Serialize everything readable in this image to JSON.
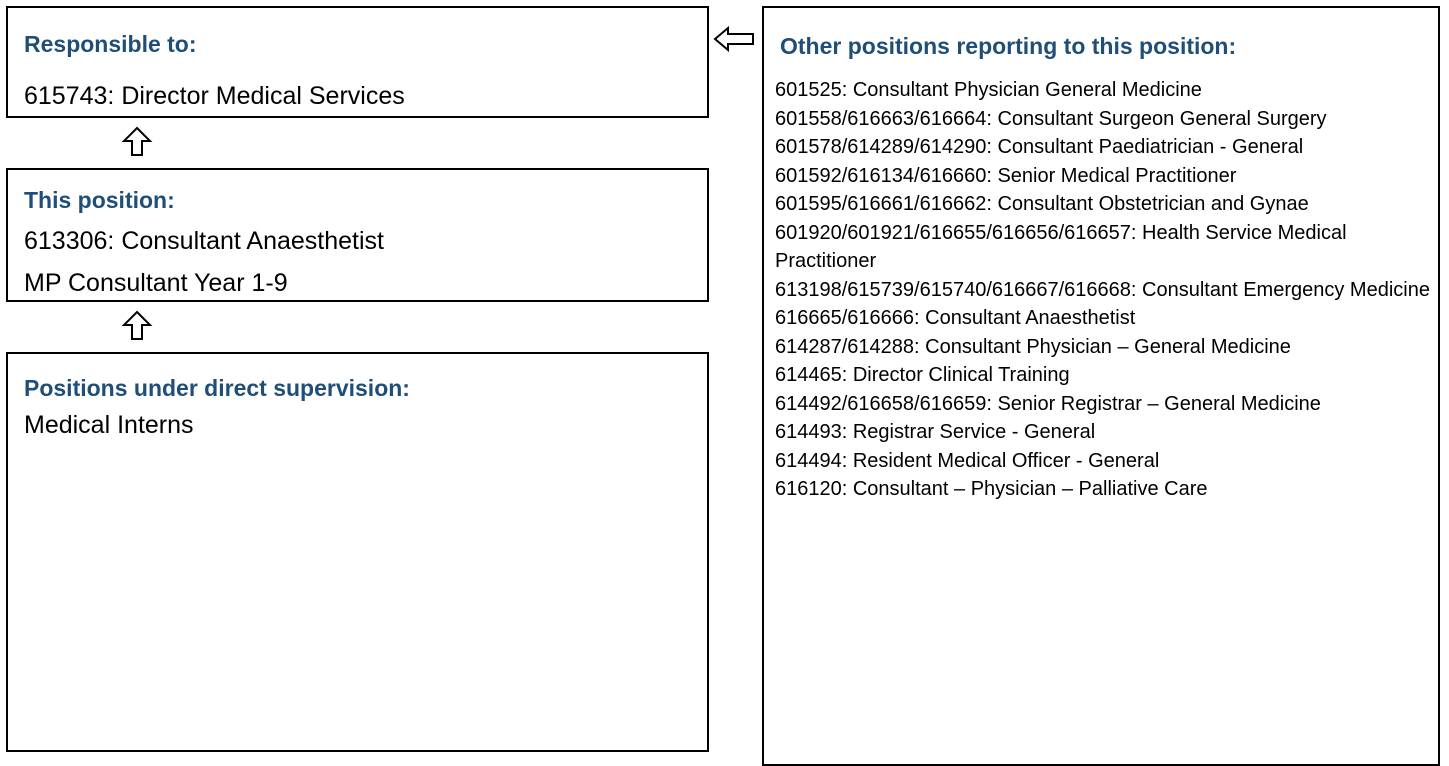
{
  "responsible": {
    "title": "Responsible to:",
    "lines": [
      "615743: Director Medical Services"
    ]
  },
  "this_position": {
    "title": "This position:",
    "lines": [
      "613306: Consultant Anaesthetist",
      "MP Consultant Year 1-9"
    ]
  },
  "direct_supervision": {
    "title": "Positions under direct supervision:",
    "lines": [
      "Medical Interns"
    ]
  },
  "other_positions": {
    "title": "Other positions reporting to this position:",
    "items": [
      "601525: Consultant Physician General Medicine",
      "601558/616663/616664: Consultant Surgeon General Surgery",
      "601578/614289/614290: Consultant Paediatrician - General",
      "601592/616134/616660: Senior Medical Practitioner",
      "601595/616661/616662: Consultant Obstetrician and Gynae",
      "601920/601921/616655/616656/616657: Health Service Medical Practitioner",
      "613198/615739/615740/616667/616668: Consultant Emergency Medicine",
      "616665/616666: Consultant Anaesthetist",
      "614287/614288: Consultant Physician – General Medicine",
      "614465: Director Clinical Training",
      "614492/616658/616659: Senior Registrar – General Medicine",
      "614493: Registrar Service - General",
      "614494: Resident Medical Officer - General",
      "616120: Consultant – Physician – Palliative Care"
    ]
  },
  "colors": {
    "heading": "#1f4e79",
    "border": "#000000",
    "text": "#000000"
  },
  "icons": {
    "up_arrow": "up-arrow-icon",
    "left_arrow": "left-arrow-icon"
  }
}
